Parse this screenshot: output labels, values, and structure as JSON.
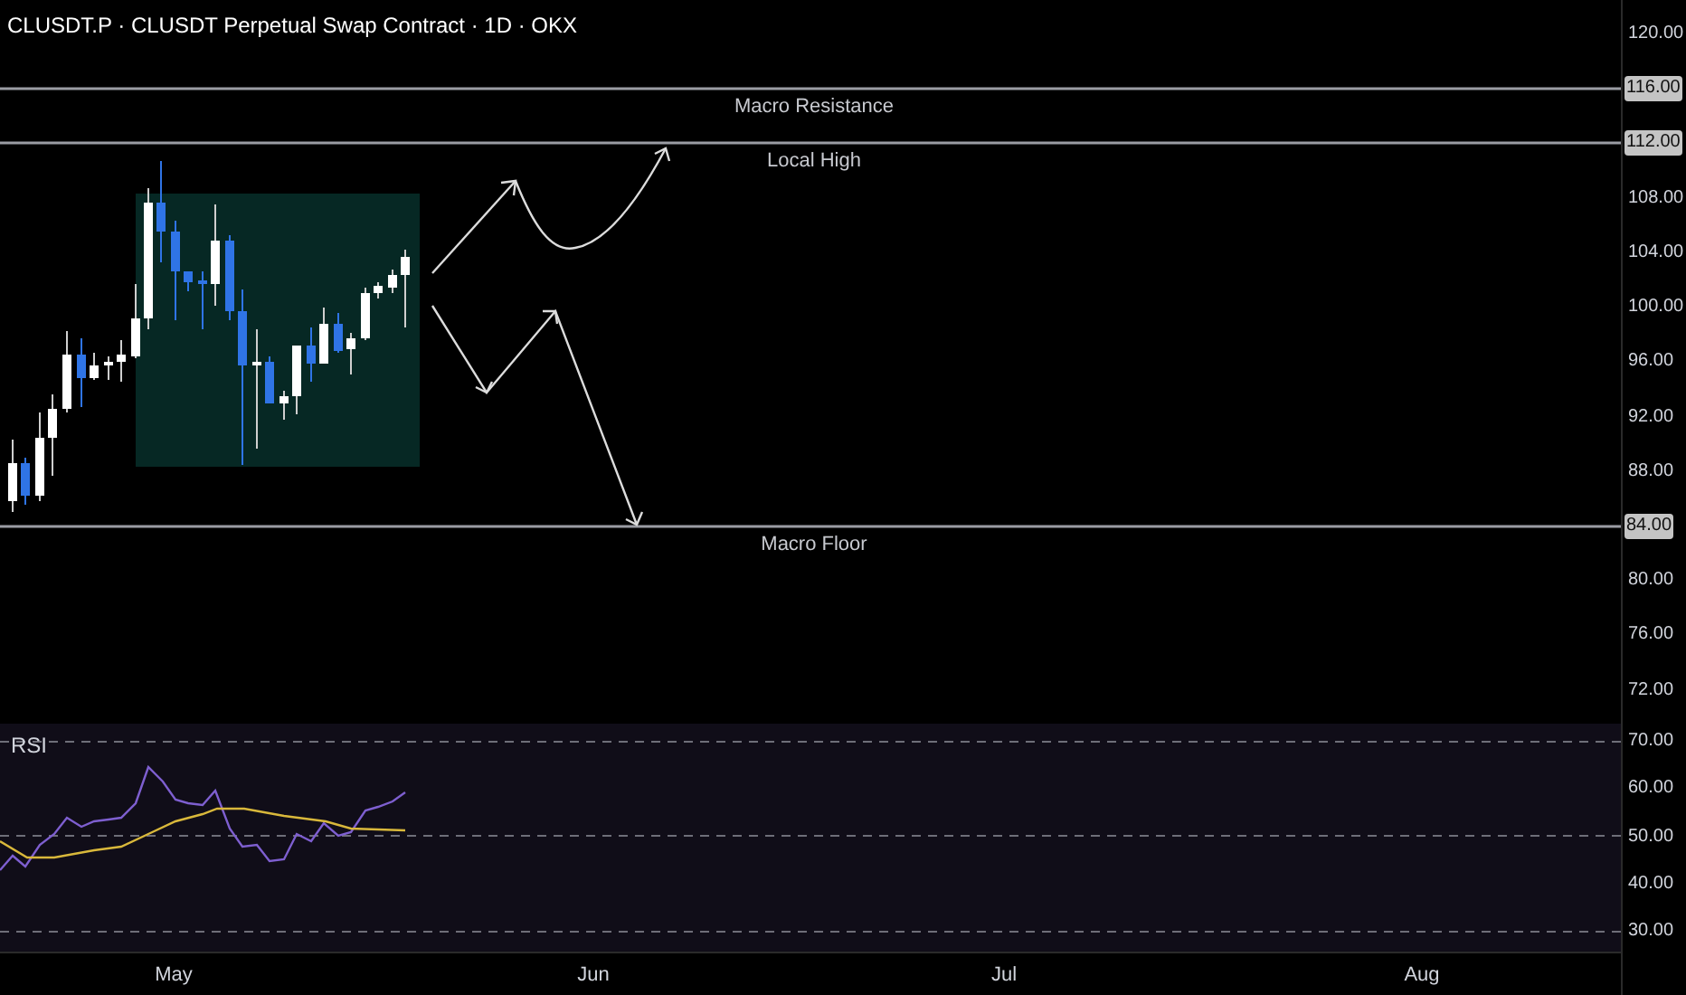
{
  "header": {
    "title": "CLUSDT.P · CLUSDT Perpetual Swap Contract · 1D · OKX"
  },
  "levels": [
    {
      "label": "Macro Resistance"
    },
    {
      "label": "Local High"
    },
    {
      "label": "Macro Floor"
    }
  ],
  "price_axis": [
    {
      "label": "120.00",
      "kind": "tick"
    },
    {
      "label": "116.00",
      "kind": "level"
    },
    {
      "label": "112.00",
      "kind": "level"
    },
    {
      "label": "108.00",
      "kind": "tick"
    },
    {
      "label": "104.00",
      "kind": "tick"
    },
    {
      "label": "100.00",
      "kind": "tick"
    },
    {
      "label": "96.00",
      "kind": "tick"
    },
    {
      "label": "92.00",
      "kind": "tick"
    },
    {
      "label": "88.00",
      "kind": "tick"
    },
    {
      "label": "84.00",
      "kind": "level"
    },
    {
      "label": "80.00",
      "kind": "tick"
    },
    {
      "label": "76.00",
      "kind": "tick"
    },
    {
      "label": "72.00",
      "kind": "tick"
    }
  ],
  "rsi_pane": {
    "label": "RSI",
    "axis": [
      "70.00",
      "60.00",
      "50.00",
      "40.00",
      "30.00"
    ]
  },
  "time_axis": [
    "May",
    "Jun",
    "Jul",
    "Aug"
  ]
}
